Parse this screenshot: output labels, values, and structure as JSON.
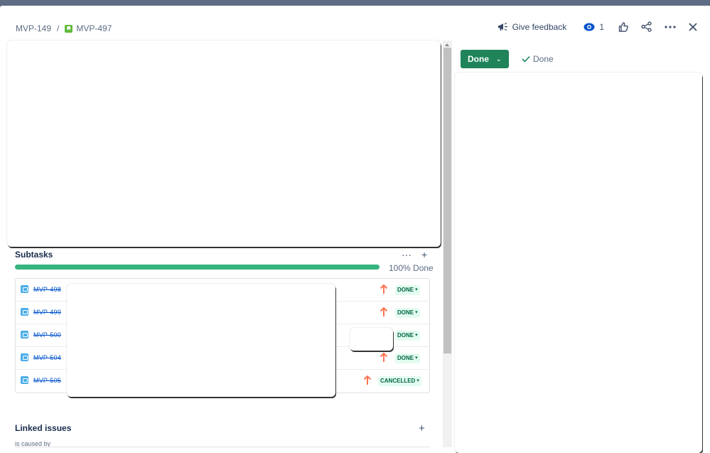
{
  "header": {
    "breadcrumb": {
      "parent_key": "MVP-149",
      "separator": "/",
      "current_key": "MVP-497"
    },
    "give_feedback_label": "Give feedback",
    "watchers_count": "1"
  },
  "subtasks": {
    "title": "Subtasks",
    "more_label": "···",
    "add_label": "+",
    "progress": {
      "percent_done": 100,
      "label": "100% Done"
    },
    "items": [
      {
        "key": "MVP-498",
        "priority": "high",
        "status": "DONE"
      },
      {
        "key": "MVP-499",
        "priority": "high",
        "status": "DONE"
      },
      {
        "key": "MVP-500",
        "priority": "high",
        "status": "DONE"
      },
      {
        "key": "MVP-504",
        "priority": "high",
        "status": "DONE"
      },
      {
        "key": "MVP-505",
        "priority": "high",
        "status": "CANCELLED"
      }
    ]
  },
  "linked_issues": {
    "title": "Linked issues",
    "add_label": "+",
    "relation_label": "is caused by"
  },
  "status_panel": {
    "status_label": "Done",
    "resolution_label": "Done"
  },
  "colors": {
    "status_done_bg": "#1f845a",
    "progress": "#36b37e",
    "priority_high": "#ff7452",
    "link": "#0052cc"
  }
}
